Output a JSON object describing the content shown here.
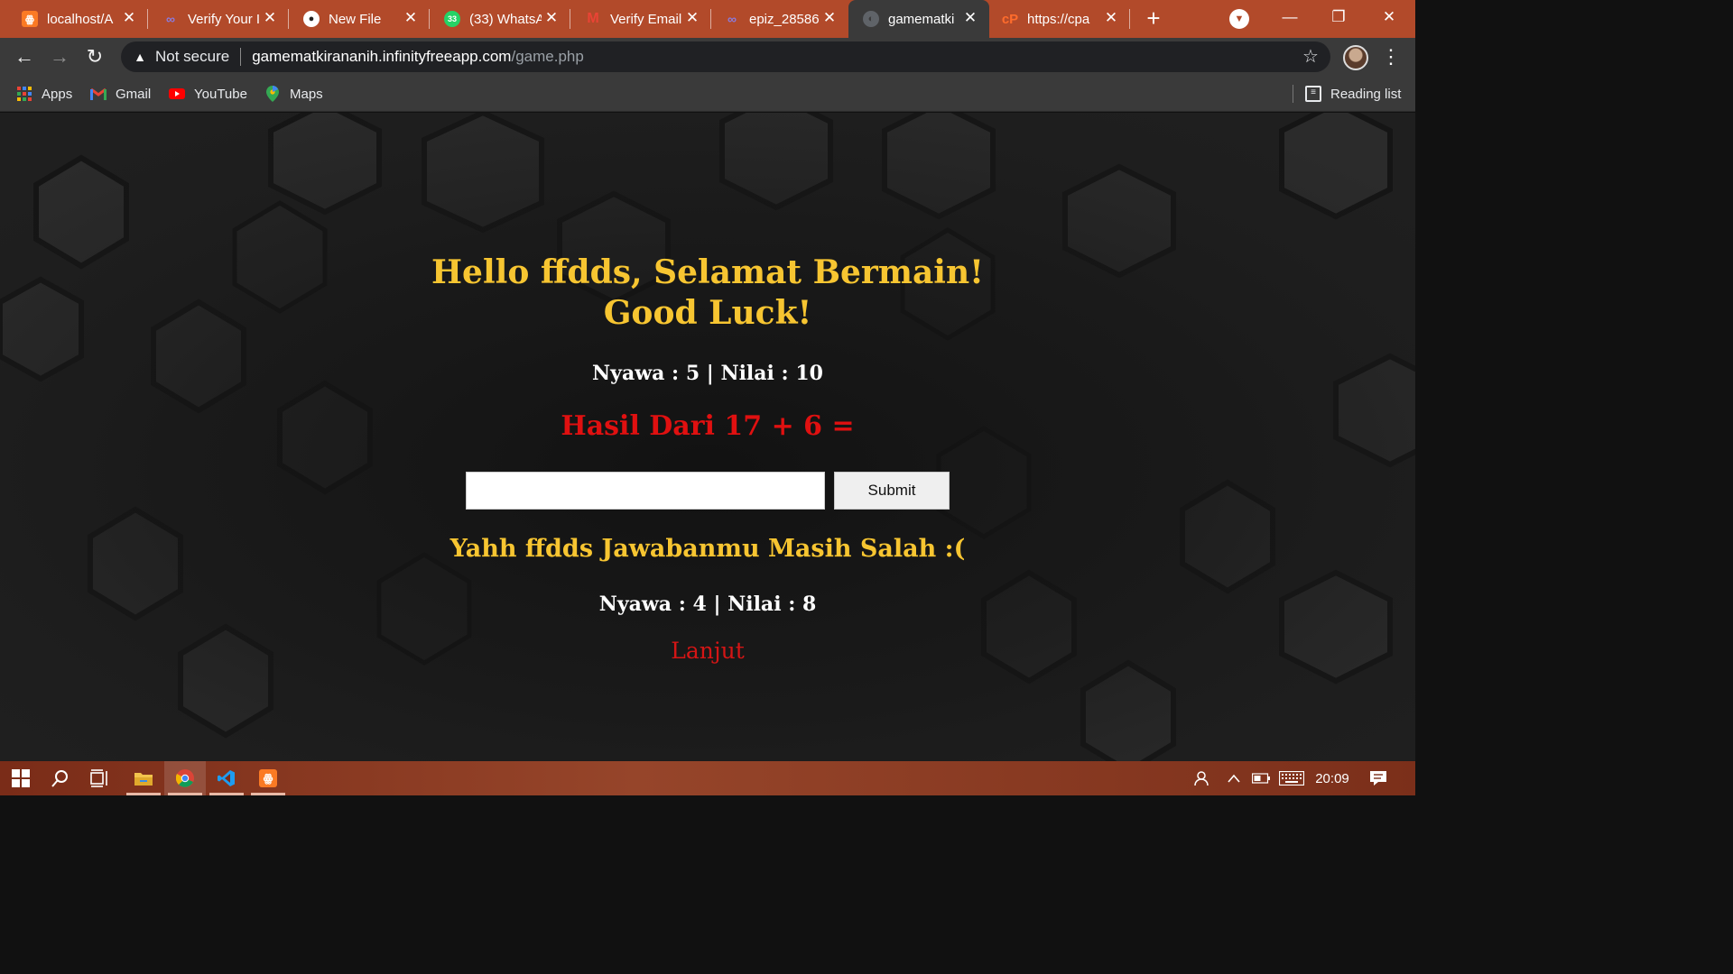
{
  "browser": {
    "tabs": [
      {
        "title": "localhost/A",
        "favicon": "xampp-icon",
        "fav_color": "#fb7a24",
        "active": false
      },
      {
        "title": "Verify Your I",
        "favicon": "cloud-icon",
        "fav_color": "#6e5bd6",
        "active": false
      },
      {
        "title": "New File",
        "favicon": "github-icon",
        "fav_color": "#ffffff",
        "active": false
      },
      {
        "title": "(33) WhatsA",
        "favicon": "whatsapp-icon",
        "fav_color": "#25d366",
        "active": false
      },
      {
        "title": "Verify Email",
        "favicon": "gmail-icon",
        "fav_color": "#ea4335",
        "active": false
      },
      {
        "title": "epiz_28586",
        "favicon": "cloud-icon",
        "fav_color": "#6e5bd6",
        "active": false
      },
      {
        "title": "gamematki",
        "favicon": "globe-icon",
        "fav_color": "#9aa0a6",
        "active": true
      },
      {
        "title": "https://cpa",
        "favicon": "cpanel-icon",
        "fav_color": "#ff6c2c",
        "active": false
      }
    ],
    "address": {
      "security_label": "Not secure",
      "host": "gamematkirananih.infinityfreeapp.com",
      "path": "/game.php"
    },
    "bookmarks": [
      {
        "label": "Apps",
        "icon": "apps-grid-icon"
      },
      {
        "label": "Gmail",
        "icon": "gmail-icon"
      },
      {
        "label": "YouTube",
        "icon": "youtube-icon"
      },
      {
        "label": "Maps",
        "icon": "maps-pin-icon"
      }
    ],
    "reading_list_label": "Reading list"
  },
  "game": {
    "greeting_line1": "Hello ffdds, Selamat Bermain!",
    "greeting_line2": "Good Luck!",
    "stats_before": "Nyawa : 5 | Nilai : 10",
    "question": "Hasil Dari 17 + 6 =",
    "answer_value": "",
    "submit_label": "Submit",
    "result_message": "Yahh ffdds Jawabanmu Masih Salah :(",
    "stats_after": "Nyawa : 4 | Nilai : 8",
    "next_link": "Lanjut",
    "colors": {
      "heading": "#f7c531",
      "question": "#e01010",
      "link": "#d41515"
    }
  },
  "taskbar": {
    "apps": [
      "windows-start-icon",
      "search-icon",
      "task-view-icon",
      "file-explorer-icon",
      "chrome-icon",
      "vscode-icon",
      "xampp-icon"
    ],
    "clock": "20:09"
  },
  "theme": {
    "tabstrip": "#b24a2a",
    "toolbar": "#3a3a3a"
  }
}
